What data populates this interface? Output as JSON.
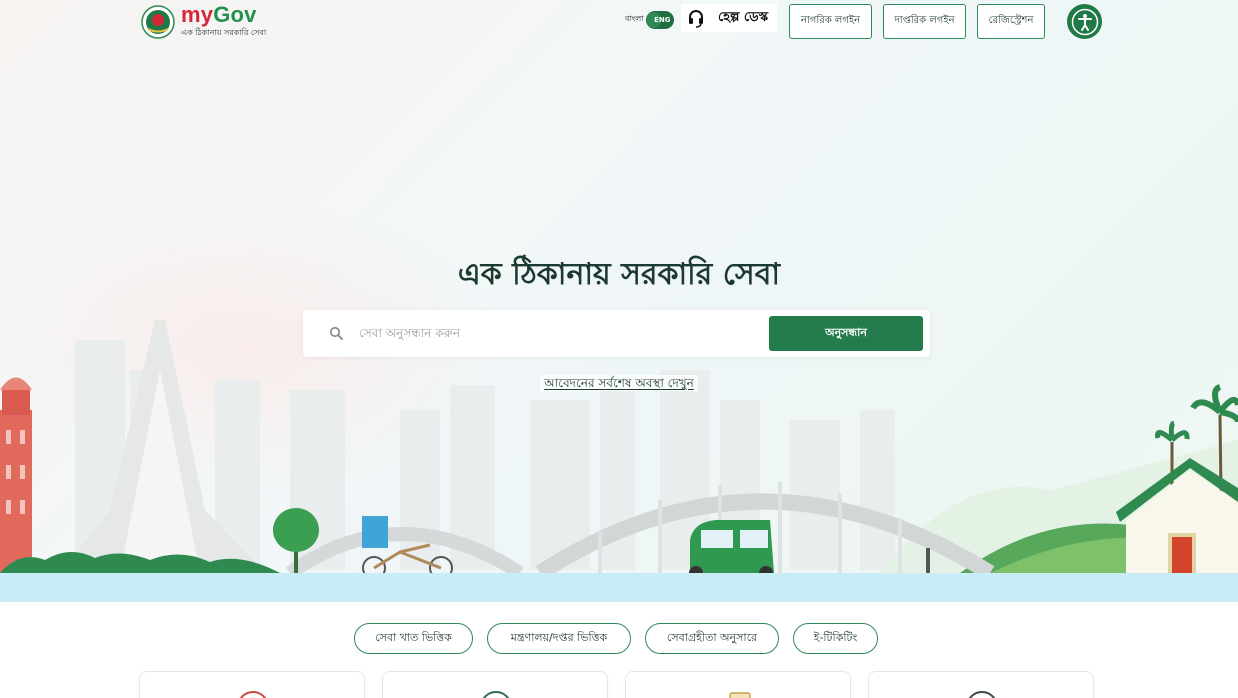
{
  "header": {
    "logo_title_my": "my",
    "logo_title_gov": "Gov",
    "logo_subtitle": "এক ঠিকানায় সরকারি সেবা",
    "lang_bn": "বাংলা",
    "lang_en": "ENG",
    "helpdesk_label": "হেল্প ডেস্ক",
    "citizen_login": "নাগরিক লগইন",
    "official_login": "দাপ্তরিক লগইন",
    "registration": "রেজিস্ট্রেশন"
  },
  "hero": {
    "title": "এক ঠিকানায় সরকারি সেবা",
    "search_placeholder": "সেবা অনুসন্ধান করুন",
    "search_button": "অনুসন্ধান",
    "status_link": "আবেদনের সর্বশেষ অবস্থা দেখুন"
  },
  "categories": [
    "সেবা খাত ভিত্তিক",
    "মন্ত্রণালয়/দপ্তর ভিত্তিক",
    "সেবাগ্রহীতা অনুসারে",
    "ই-টিকিটিং"
  ],
  "colors": {
    "brand_green": "#247c4d",
    "brand_red": "#d4283a",
    "water": "#c9ecf6"
  },
  "icons": {
    "emblem": "bangladesh-emblem-icon",
    "helpdesk": "headset-icon",
    "accessibility": "accessibility-icon",
    "search": "search-icon"
  }
}
